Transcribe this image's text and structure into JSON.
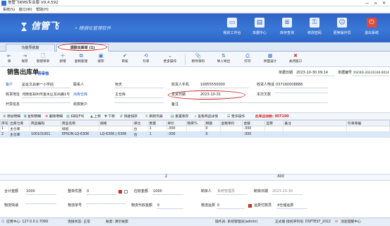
{
  "window": {
    "title": "信管飞RMS专业版 V9.4.592",
    "btn_min": "—",
    "btn_max": "▫",
    "btn_close": "✕"
  },
  "menu": [
    "系统(S)",
    "窗口(W)",
    "帮助(H)"
  ],
  "banner": {
    "brand": "信管飞",
    "slogan": "• 精细化管理软件",
    "buttons": [
      "我的工作台",
      "单据中心",
      "库存查询",
      "修改密码",
      "更换操作员",
      "退出系统"
    ]
  },
  "tabs": [
    "功能导航窗",
    "调拨出库单 (1)"
  ],
  "toolbar": [
    "单",
    "保存",
    "新建草单",
    "新增",
    "复制新建",
    "保存",
    "审核",
    "引单",
    "更多操作",
    "附件资料",
    "导入导出",
    "打印",
    "界面设计",
    "关闭窗口"
  ],
  "form": {
    "title": "销售出库单",
    "status": "待审核",
    "doc_date_label": "单据日期",
    "doc_date": "2023-10-30 09:14",
    "doc_no_label": "单据编号",
    "doc_no": "XSCKD-20231030-0014",
    "customer_label": "客户",
    "customer": "星星文具第一小学店",
    "contact_label": "联系人",
    "contact": "杨天",
    "mobile_label": "收货人手机",
    "mobile": "19955550000",
    "phone_label": "收货人电话",
    "phone": "037160008888",
    "address_label": "收货地址",
    "address": "河南省郑州市金水区东风路1号",
    "warehouse_label": "出库仓库",
    "warehouse": "主仓库",
    "ship_date_label": "发货日期",
    "ship_date": "2023-10-31",
    "remaining_label": "本次欠款",
    "remaining": "",
    "credit_label": "开票信息",
    "credit": "",
    "account_label": "收款账户",
    "account": "",
    "note_label": "备注",
    "note": ""
  },
  "gridbar": [
    "添加明细",
    "复制明细",
    "删除明细",
    "扫码(F4)",
    "上移",
    "下移",
    "快捷排序",
    "刷新列表",
    "重置库存",
    "查看商品详情",
    "更多操作"
  ],
  "gridbar_warning": "此单应收款: 95T190",
  "grid": {
    "headers": [
      "序号",
      "出库仓库",
      "商品编码",
      "商品名称",
      "规格",
      "单位",
      "数量",
      "单价",
      "税率%",
      "税额",
      "含税单价",
      "金额",
      "运费",
      "备注",
      "引单单据"
    ],
    "rows": [
      [
        "1",
        "主仓库",
        "",
        "抹纸",
        "",
        "台",
        "1",
        "-300",
        "",
        "0",
        "",
        "-300",
        "",
        "",
        ""
      ],
      [
        "2",
        "主仓库",
        "100101001",
        "EPSON LQ-630K",
        "LQ-630K | 630K",
        "台",
        "1",
        "-300",
        "",
        "0",
        "",
        "-300",
        "",
        "",
        ""
      ]
    ],
    "total_qty": "2",
    "total_amount": "-600"
  },
  "summary": {
    "subtotal_label": "合计金额",
    "subtotal": "1000",
    "discount_label": "整单优惠",
    "discount": "0",
    "receivable_label": "应收金额",
    "receivable": "1000",
    "creator_label": "制单人",
    "creator": "系统管理员",
    "created_label": "制单日期",
    "created": "2023-10-30",
    "logistics_label": "物流快递",
    "logistics": "",
    "tracking_label": "物流单号",
    "tracking": "",
    "logistic_fee_label": "物流代收金额",
    "logistic_fee": "0",
    "shipping_label": "物流运费",
    "shipping": "0",
    "shipping_pay_label": "运费付款员",
    "shipping_pay": "4仓储运费"
  },
  "statusbar": {
    "server": "应用中心: 127.0.0.1:7099",
    "conn": "连接状态: 正常",
    "workspace": "账套: 演示账套",
    "operator": "操作员: 系统管理员(admin)",
    "license": "正式版 授权序列号: DSFTEST_2022",
    "msg": "消息提醒中心"
  }
}
